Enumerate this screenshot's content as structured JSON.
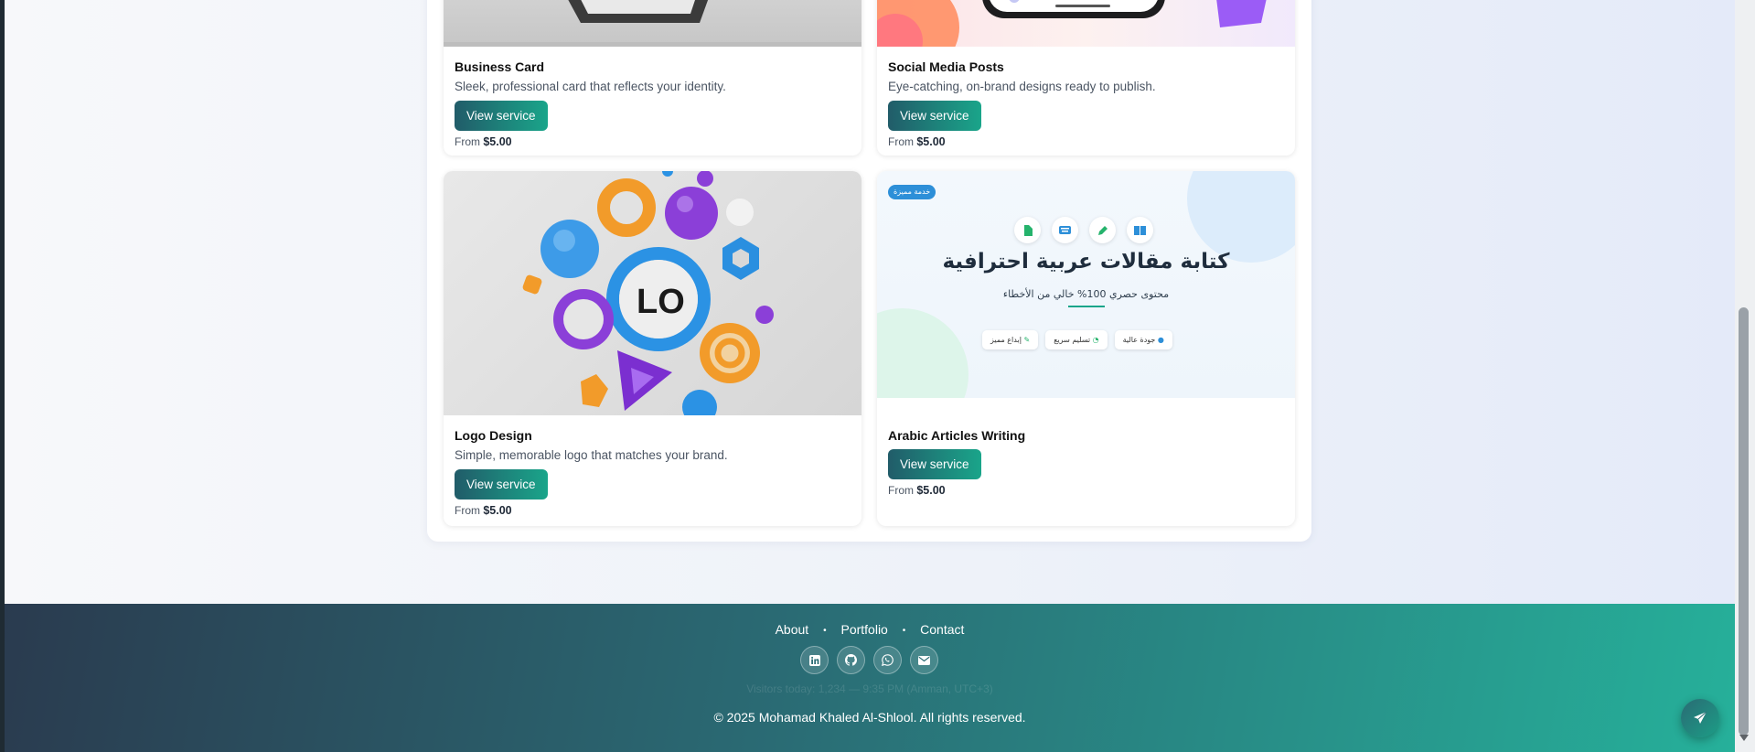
{
  "services": [
    {
      "title": "Business Card",
      "description": "Sleek, professional card that reflects your identity.",
      "button": "View service",
      "price_prefix": "From",
      "price": "$5.00"
    },
    {
      "title": "Social Media Posts",
      "description": "Eye-catching, on-brand designs ready to publish.",
      "button": "View service",
      "price_prefix": "From",
      "price": "$5.00"
    },
    {
      "title": "Logo Design",
      "description": "Simple, memorable logo that matches your brand.",
      "button": "View service",
      "price_prefix": "From",
      "price": "$5.00",
      "image_text": "LO"
    },
    {
      "title": "Arabic Articles Writing",
      "button": "View service",
      "price_prefix": "From",
      "price": "$5.00",
      "image": {
        "badge": "خدمة مميزة",
        "headline": "كتابة مقالات عربية احترافية",
        "subline": "محتوى حصري 100% خالي من الأخطاء",
        "chips": [
          "جودة عالية",
          "تسليم سريع",
          "إبداع مميز"
        ]
      }
    }
  ],
  "footer": {
    "nav": [
      "About",
      "Portfolio",
      "Contact"
    ],
    "social_icons": [
      "linkedin-icon",
      "github-icon",
      "whatsapp-icon",
      "mail-icon"
    ],
    "visitors_text": "Visitors today: 1,234 — 9:35 PM (Amman, UTC+3)",
    "copyright": "© 2025 Mohamad Khaled Al-Shlool. All rights reserved."
  },
  "colors": {
    "accent_start": "#215c69",
    "accent_end": "#1aa58a",
    "footer_start": "#2a3b4f",
    "footer_end": "#26b09a"
  }
}
